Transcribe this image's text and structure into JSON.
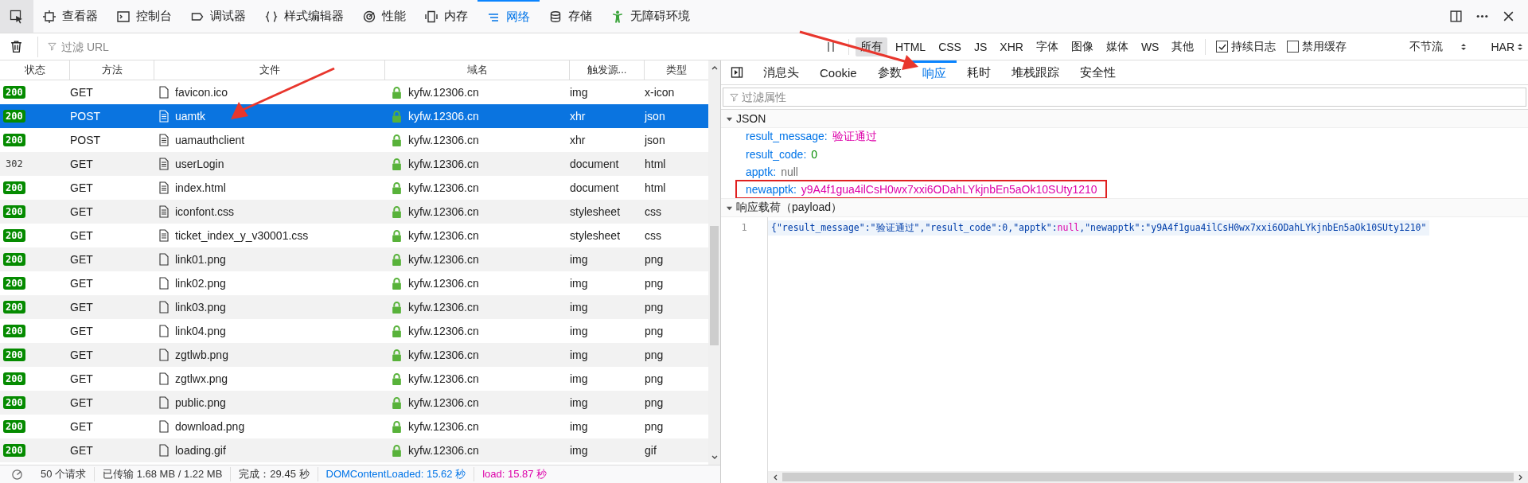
{
  "tools": [
    {
      "label": "查看器",
      "selected": false
    },
    {
      "label": "控制台",
      "selected": false
    },
    {
      "label": "调试器",
      "selected": false
    },
    {
      "label": "样式编辑器",
      "selected": false
    },
    {
      "label": "性能",
      "selected": false
    },
    {
      "label": "内存",
      "selected": false
    },
    {
      "label": "网络",
      "selected": true
    },
    {
      "label": "存储",
      "selected": false
    },
    {
      "label": "无障碍环境",
      "selected": false
    }
  ],
  "filter": {
    "placeholder": "过滤 URL"
  },
  "type_filters": [
    {
      "label": "所有",
      "selected": true
    },
    {
      "label": "HTML",
      "selected": false
    },
    {
      "label": "CSS",
      "selected": false
    },
    {
      "label": "JS",
      "selected": false
    },
    {
      "label": "XHR",
      "selected": false
    },
    {
      "label": "字体",
      "selected": false
    },
    {
      "label": "图像",
      "selected": false
    },
    {
      "label": "媒体",
      "selected": false
    },
    {
      "label": "WS",
      "selected": false
    },
    {
      "label": "其他",
      "selected": false
    }
  ],
  "options": [
    {
      "label": "持续日志",
      "checked": true
    },
    {
      "label": "禁用缓存",
      "checked": false
    }
  ],
  "throttle": "不节流",
  "har": "HAR",
  "columns": [
    "状态",
    "方法",
    "文件",
    "域名",
    "触发源...",
    "类型"
  ],
  "rows": [
    {
      "status": {
        "code": "200",
        "kind": "ok"
      },
      "method": "GET",
      "file": "favicon.ico",
      "kind": "plain",
      "domain": "kyfw.12306.cn",
      "cause": "img",
      "type": "x-icon",
      "selected": false
    },
    {
      "status": {
        "code": "200",
        "kind": "ok"
      },
      "method": "POST",
      "file": "uamtk",
      "kind": "document",
      "domain": "kyfw.12306.cn",
      "cause": "xhr",
      "type": "json",
      "selected": true
    },
    {
      "status": {
        "code": "200",
        "kind": "ok"
      },
      "method": "POST",
      "file": "uamauthclient",
      "kind": "document",
      "domain": "kyfw.12306.cn",
      "cause": "xhr",
      "type": "json",
      "selected": false
    },
    {
      "status": {
        "code": "302",
        "kind": "redirect"
      },
      "method": "GET",
      "file": "userLogin",
      "kind": "document",
      "domain": "kyfw.12306.cn",
      "cause": "document",
      "type": "html",
      "selected": false
    },
    {
      "status": {
        "code": "200",
        "kind": "ok"
      },
      "method": "GET",
      "file": "index.html",
      "kind": "document",
      "domain": "kyfw.12306.cn",
      "cause": "document",
      "type": "html",
      "selected": false
    },
    {
      "status": {
        "code": "200",
        "kind": "ok"
      },
      "method": "GET",
      "file": "iconfont.css",
      "kind": "document",
      "domain": "kyfw.12306.cn",
      "cause": "stylesheet",
      "type": "css",
      "selected": false
    },
    {
      "status": {
        "code": "200",
        "kind": "ok"
      },
      "method": "GET",
      "file": "ticket_index_y_v30001.css",
      "kind": "document",
      "domain": "kyfw.12306.cn",
      "cause": "stylesheet",
      "type": "css",
      "selected": false
    },
    {
      "status": {
        "code": "200",
        "kind": "ok"
      },
      "method": "GET",
      "file": "link01.png",
      "kind": "plain",
      "domain": "kyfw.12306.cn",
      "cause": "img",
      "type": "png",
      "selected": false
    },
    {
      "status": {
        "code": "200",
        "kind": "ok"
      },
      "method": "GET",
      "file": "link02.png",
      "kind": "plain",
      "domain": "kyfw.12306.cn",
      "cause": "img",
      "type": "png",
      "selected": false
    },
    {
      "status": {
        "code": "200",
        "kind": "ok"
      },
      "method": "GET",
      "file": "link03.png",
      "kind": "plain",
      "domain": "kyfw.12306.cn",
      "cause": "img",
      "type": "png",
      "selected": false
    },
    {
      "status": {
        "code": "200",
        "kind": "ok"
      },
      "method": "GET",
      "file": "link04.png",
      "kind": "plain",
      "domain": "kyfw.12306.cn",
      "cause": "img",
      "type": "png",
      "selected": false
    },
    {
      "status": {
        "code": "200",
        "kind": "ok"
      },
      "method": "GET",
      "file": "zgtlwb.png",
      "kind": "plain",
      "domain": "kyfw.12306.cn",
      "cause": "img",
      "type": "png",
      "selected": false
    },
    {
      "status": {
        "code": "200",
        "kind": "ok"
      },
      "method": "GET",
      "file": "zgtlwx.png",
      "kind": "plain",
      "domain": "kyfw.12306.cn",
      "cause": "img",
      "type": "png",
      "selected": false
    },
    {
      "status": {
        "code": "200",
        "kind": "ok"
      },
      "method": "GET",
      "file": "public.png",
      "kind": "plain",
      "domain": "kyfw.12306.cn",
      "cause": "img",
      "type": "png",
      "selected": false
    },
    {
      "status": {
        "code": "200",
        "kind": "ok"
      },
      "method": "GET",
      "file": "download.png",
      "kind": "plain",
      "domain": "kyfw.12306.cn",
      "cause": "img",
      "type": "png",
      "selected": false
    },
    {
      "status": {
        "code": "200",
        "kind": "ok"
      },
      "method": "GET",
      "file": "loading.gif",
      "kind": "plain",
      "domain": "kyfw.12306.cn",
      "cause": "img",
      "type": "gif",
      "selected": false
    }
  ],
  "status_bar": [
    {
      "text": "50 个请求",
      "kind": "plain"
    },
    {
      "text": "已传输 1.68 MB / 1.22 MB",
      "kind": "plain"
    },
    {
      "text": "完成：29.45 秒",
      "kind": "plain"
    },
    {
      "text": "DOMContentLoaded: 15.62 秒",
      "kind": "dom"
    },
    {
      "text": "load: 15.87 秒",
      "kind": "load"
    }
  ],
  "detail_tabs": [
    {
      "label": "消息头",
      "selected": false
    },
    {
      "label": "Cookie",
      "selected": false
    },
    {
      "label": "参数",
      "selected": false
    },
    {
      "label": "响应",
      "selected": true
    },
    {
      "label": "耗时",
      "selected": false
    },
    {
      "label": "堆栈跟踪",
      "selected": false
    },
    {
      "label": "安全性",
      "selected": false
    }
  ],
  "props_filter": {
    "placeholder": "过滤属性"
  },
  "json_section": {
    "title": "JSON",
    "expanded": true,
    "entries": [
      {
        "key": "result_message:",
        "value": "验证通过",
        "kind": "string",
        "boxed": false
      },
      {
        "key": "result_code:",
        "value": "0",
        "kind": "number",
        "boxed": false
      },
      {
        "key": "apptk:",
        "value": "null",
        "kind": "null",
        "boxed": false
      },
      {
        "key": "newapptk:",
        "value": "y9A4f1gua4ilCsH0wx7xxi6ODahLYkjnbEn5aOk10SUty1210",
        "kind": "string",
        "boxed": true
      }
    ]
  },
  "payload": {
    "title": "响应载荷（payload）",
    "expanded": true,
    "line_number": "1",
    "tokens": [
      {
        "text": "{\"result_message\":\"验证通过\",\"result_code\":0,\"apptk\":",
        "kind": "text"
      },
      {
        "text": "null",
        "kind": "null"
      },
      {
        "text": ",\"newapptk\":\"y9A4f1gua4ilCsH0wx7xxi6ODahLYkjnbEn5aOk10SUty1210\"",
        "kind": "text"
      }
    ]
  }
}
